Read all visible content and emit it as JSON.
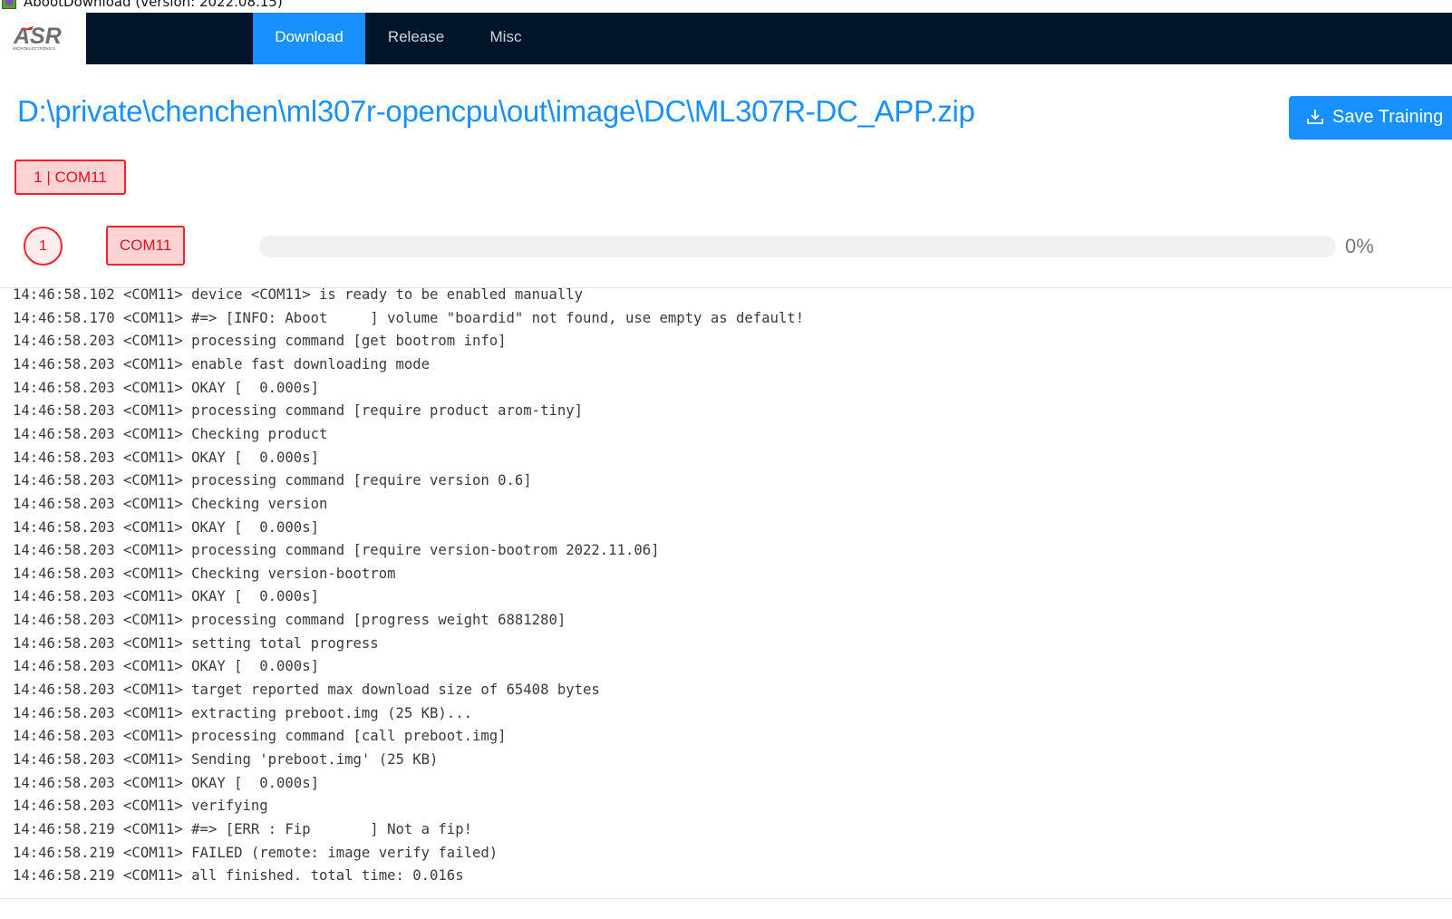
{
  "window": {
    "title": "AbootDownload (version: 2022.08.15)",
    "icon": "app-icon"
  },
  "logo": {
    "text": "ASR",
    "subtext": "MICROELECTRONICS"
  },
  "nav": {
    "items": [
      {
        "label": "Download",
        "active": true
      },
      {
        "label": "Release",
        "active": false
      },
      {
        "label": "Misc",
        "active": false
      }
    ]
  },
  "path": "D:\\private\\chenchen\\ml307r-opencpu\\out\\image\\DC\\ML307R-DC_APP.zip",
  "save_button": {
    "label": "Save Training",
    "icon": "download-icon"
  },
  "device_tag": "1 | COM11",
  "device_row": {
    "slot": "1",
    "port": "COM11",
    "progress": 0,
    "progress_text": "0%"
  },
  "log": [
    "14:46:58.102 <COM11> device <COM11> is ready to be enabled manually",
    "14:46:58.170 <COM11> #=> [INFO: Aboot     ] volume \"boardid\" not found, use empty as default!",
    "14:46:58.203 <COM11> processing command [get bootrom info]",
    "14:46:58.203 <COM11> enable fast downloading mode",
    "14:46:58.203 <COM11> OKAY [  0.000s]",
    "14:46:58.203 <COM11> processing command [require product arom-tiny]",
    "14:46:58.203 <COM11> Checking product",
    "14:46:58.203 <COM11> OKAY [  0.000s]",
    "14:46:58.203 <COM11> processing command [require version 0.6]",
    "14:46:58.203 <COM11> Checking version",
    "14:46:58.203 <COM11> OKAY [  0.000s]",
    "14:46:58.203 <COM11> processing command [require version-bootrom 2022.11.06]",
    "14:46:58.203 <COM11> Checking version-bootrom",
    "14:46:58.203 <COM11> OKAY [  0.000s]",
    "14:46:58.203 <COM11> processing command [progress weight 6881280]",
    "14:46:58.203 <COM11> setting total progress",
    "14:46:58.203 <COM11> OKAY [  0.000s]",
    "14:46:58.203 <COM11> target reported max download size of 65408 bytes",
    "14:46:58.203 <COM11> extracting preboot.img (25 KB)...",
    "14:46:58.203 <COM11> processing command [call preboot.img]",
    "14:46:58.203 <COM11> Sending 'preboot.img' (25 KB)",
    "14:46:58.203 <COM11> OKAY [  0.000s]",
    "14:46:58.203 <COM11> verifying",
    "14:46:58.219 <COM11> #=> [ERR : Fip       ] Not a fip!",
    "14:46:58.219 <COM11> FAILED (remote: image verify failed)",
    "14:46:58.219 <COM11> all finished. total time: 0.016s"
  ]
}
